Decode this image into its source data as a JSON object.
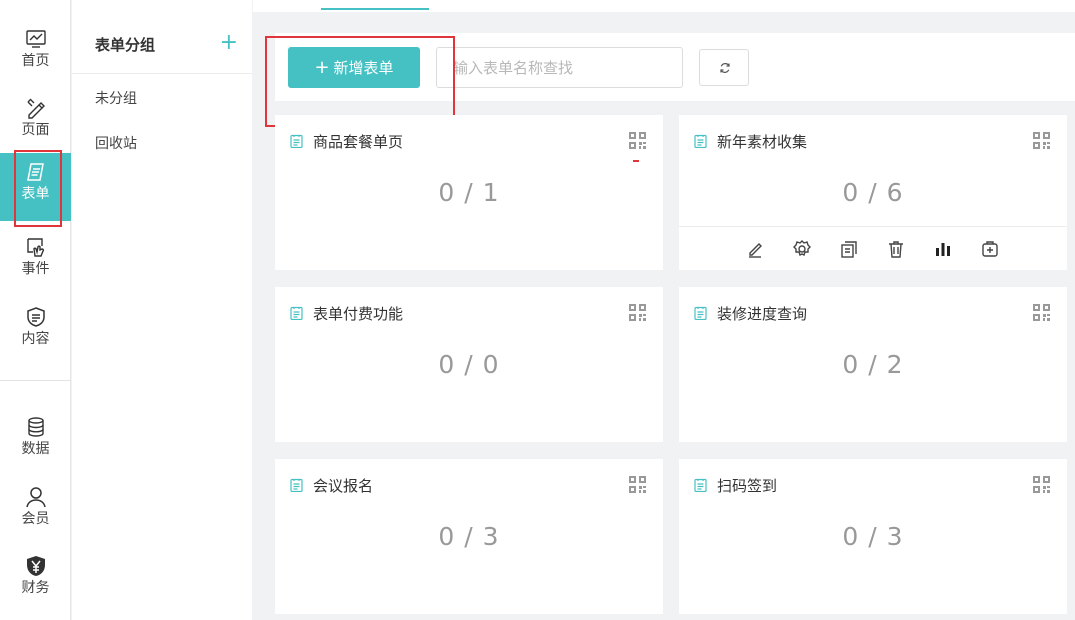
{
  "nav": {
    "items": [
      {
        "label": "首页",
        "icon": "monitor-icon"
      },
      {
        "label": "页面",
        "icon": "design-tools-icon"
      },
      {
        "label": "表单",
        "icon": "form-icon"
      },
      {
        "label": "事件",
        "icon": "touch-icon"
      },
      {
        "label": "内容",
        "icon": "content-shield-icon"
      },
      {
        "label": "数据",
        "icon": "database-icon"
      },
      {
        "label": "会员",
        "icon": "user-icon"
      },
      {
        "label": "财务",
        "icon": "yen-shield-icon"
      }
    ],
    "active": "表单"
  },
  "groups": {
    "title": "表单分组",
    "add_symbol": "+",
    "items": [
      "未分组",
      "回收站"
    ]
  },
  "toolbar": {
    "new_button_plus": "+",
    "new_button_label": "新增表单",
    "search_placeholder": "输入表单名称查找",
    "refresh_icon": "refresh-icon"
  },
  "forms": [
    {
      "name": "商品套餐单页",
      "count": "0 / 1"
    },
    {
      "name": "新年素材收集",
      "count": "0 / 6",
      "actions": [
        "edit-icon",
        "settings-icon",
        "copy-icon",
        "delete-icon",
        "stats-icon",
        "add-icon"
      ]
    },
    {
      "name": "表单付费功能",
      "count": "0 / 0"
    },
    {
      "name": "装修进度查询",
      "count": "0 / 2"
    },
    {
      "name": "会议报名",
      "count": "0 / 3"
    },
    {
      "name": "扫码签到",
      "count": "0 / 3"
    }
  ],
  "colors": {
    "accent": "#46c1c3",
    "highlight": "#e0363b"
  }
}
